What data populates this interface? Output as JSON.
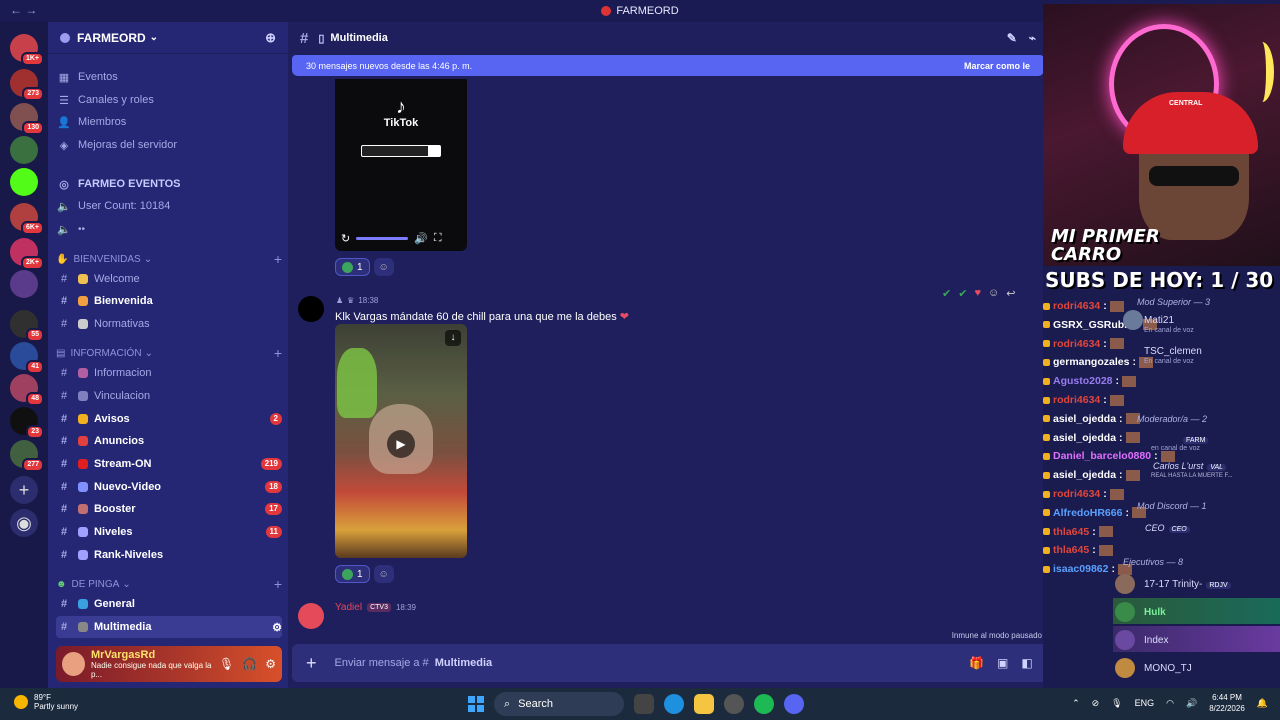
{
  "titlebar": {
    "nav": "← →",
    "title": "FARMEORD"
  },
  "colors": {
    "accent": "#5865f2",
    "bg": "#1e1f5c",
    "sidebar": "#252775",
    "badge": "#e2383d"
  },
  "servers": [
    {
      "badge": "1K+",
      "color": "#c8404a"
    },
    {
      "badge": "273",
      "color": "#a03030"
    },
    {
      "badge": "130",
      "color": "#805050"
    },
    {
      "badge": "",
      "color": "#3a7040"
    },
    {
      "badge": "",
      "color": "#53fc18"
    },
    {
      "badge": "6K+",
      "color": "#b04040"
    },
    {
      "badge": "2K+",
      "color": "#c03060"
    },
    {
      "badge": "",
      "color": "#5a3a8a"
    },
    {
      "badge": "55",
      "color": "#303030"
    },
    {
      "badge": "41",
      "color": "#2a4a9a"
    },
    {
      "badge": "48",
      "color": "#a04060"
    },
    {
      "badge": "23",
      "color": "#101010"
    },
    {
      "badge": "277",
      "color": "#406040"
    }
  ],
  "guild": {
    "name": "FARMEORD",
    "dropdown_icon": "chevron-down-icon"
  },
  "top_items": [
    {
      "icon": "calendar-icon",
      "label": "Eventos"
    },
    {
      "icon": "channels-roles-icon",
      "label": "Canales y roles"
    },
    {
      "icon": "members-icon",
      "label": "Miembros"
    },
    {
      "icon": "boost-icon",
      "label": "Mejoras del servidor"
    }
  ],
  "farmeo_eventos": {
    "title": "FARMEO EVENTOS",
    "user_count": "User Count: 10184"
  },
  "categories": {
    "bienvenidas": "BIENVENIDAS",
    "informacion": "INFORMACIÓN",
    "de_pinga": "DE PINGA"
  },
  "channels": [
    {
      "label": "Welcome",
      "bold": false,
      "count": ""
    },
    {
      "label": "Bienvenida",
      "bold": true,
      "count": ""
    },
    {
      "label": "Normativas",
      "bold": false,
      "count": ""
    },
    {
      "label": "Informacion",
      "bold": false,
      "count": ""
    },
    {
      "label": "Vinculacion",
      "bold": false,
      "count": ""
    },
    {
      "label": "Avisos",
      "bold": true,
      "count": "2"
    },
    {
      "label": "Anuncios",
      "bold": true,
      "count": ""
    },
    {
      "label": "Stream-ON",
      "bold": true,
      "count": "219"
    },
    {
      "label": "Nuevo-Video",
      "bold": true,
      "count": "18"
    },
    {
      "label": "Booster",
      "bold": true,
      "count": "17"
    },
    {
      "label": "Niveles",
      "bold": true,
      "count": "11"
    },
    {
      "label": "Rank-Niveles",
      "bold": true,
      "count": ""
    },
    {
      "label": "General",
      "bold": true,
      "count": ""
    },
    {
      "label": "Multimedia",
      "bold": true,
      "count": ""
    }
  ],
  "user": {
    "name": "MrVargasRd",
    "status": "Nadie consigue nada que valga la p..."
  },
  "channel_header": {
    "name": "Multimedia"
  },
  "new_messages": {
    "text": "30 mensajes nuevos desde las 4:46 p. m.",
    "mark": "Marcar como le"
  },
  "tiktok": {
    "logo": "TikTok"
  },
  "reactions": {
    "count1": "1",
    "count2": "1"
  },
  "message": {
    "time": "18:38",
    "text": "Klk Vargas mándate 60 de chill para una que me la debes"
  },
  "yadiel": {
    "name": "Yadiel",
    "tag": "CTV3",
    "time": "18:39"
  },
  "immune": "Inmune al modo pausado",
  "composer": {
    "placeholder": "Enviar mensaje a #",
    "channel": "Multimedia"
  },
  "stream": {
    "overlay_title": "MI PRIMER CARRO",
    "cap_text": "CENTRAL",
    "subs": "SUBS DE HOY: 1 / 30"
  },
  "chat_lines": [
    {
      "user": "rodri4634",
      "color": "#e0463c"
    },
    {
      "user": "GSRX_GSRubio",
      "color": "#ffffff"
    },
    {
      "user": "rodri4634",
      "color": "#e0463c"
    },
    {
      "user": "germangozales",
      "color": "#ffffff"
    },
    {
      "user": "Agusto2028",
      "color": "#9a7cf0"
    },
    {
      "user": "rodri4634",
      "color": "#e0463c"
    },
    {
      "user": "asiel_ojedda",
      "color": "#ffffff"
    },
    {
      "user": "asiel_ojedda",
      "color": "#ffffff"
    },
    {
      "user": "Daniel_barcelo0880",
      "color": "#e070ff"
    },
    {
      "user": "asiel_ojedda",
      "color": "#ffffff"
    },
    {
      "user": "rodri4634",
      "color": "#e0463c"
    },
    {
      "user": "AlfredoHR666",
      "color": "#5aa0ff"
    },
    {
      "user": "thla645",
      "color": "#e0463c"
    },
    {
      "user": "thla645",
      "color": "#e0463c"
    },
    {
      "user": "isaac09862",
      "color": "#5aa0ff"
    }
  ],
  "members": {
    "mod_superior": "Mod Superior — 3",
    "mati": "Mati21",
    "mati_sub": "En canal de voz",
    "tsc": "TSC_clemen",
    "tsc_sub": "En canal de voz",
    "moderador": "Moderador/a — 2",
    "farm_tag": "FARM",
    "farm_sub": "en canal de voz",
    "carlos": "Carlos L'urst",
    "val_tag": "VAL",
    "carlos_sub": "REAL HASTA LA MUERTE F...",
    "mod_discord": "Mod Discord — 1",
    "ceo": "CEO",
    "ceo_tag": "CEO",
    "ejecutivos": "Ejecutivos — 8",
    "trinity": "17-17 Trinity-",
    "trinity_tag": "RDJV",
    "hulk": "Hulk",
    "index": "Index",
    "mono": "MONO_TJ"
  },
  "taskbar": {
    "temp": "89°F",
    "weather": "Partly sunny",
    "search": "Search",
    "lang": "ENG",
    "time": "6:44 PM",
    "date": "8/22/2026"
  }
}
